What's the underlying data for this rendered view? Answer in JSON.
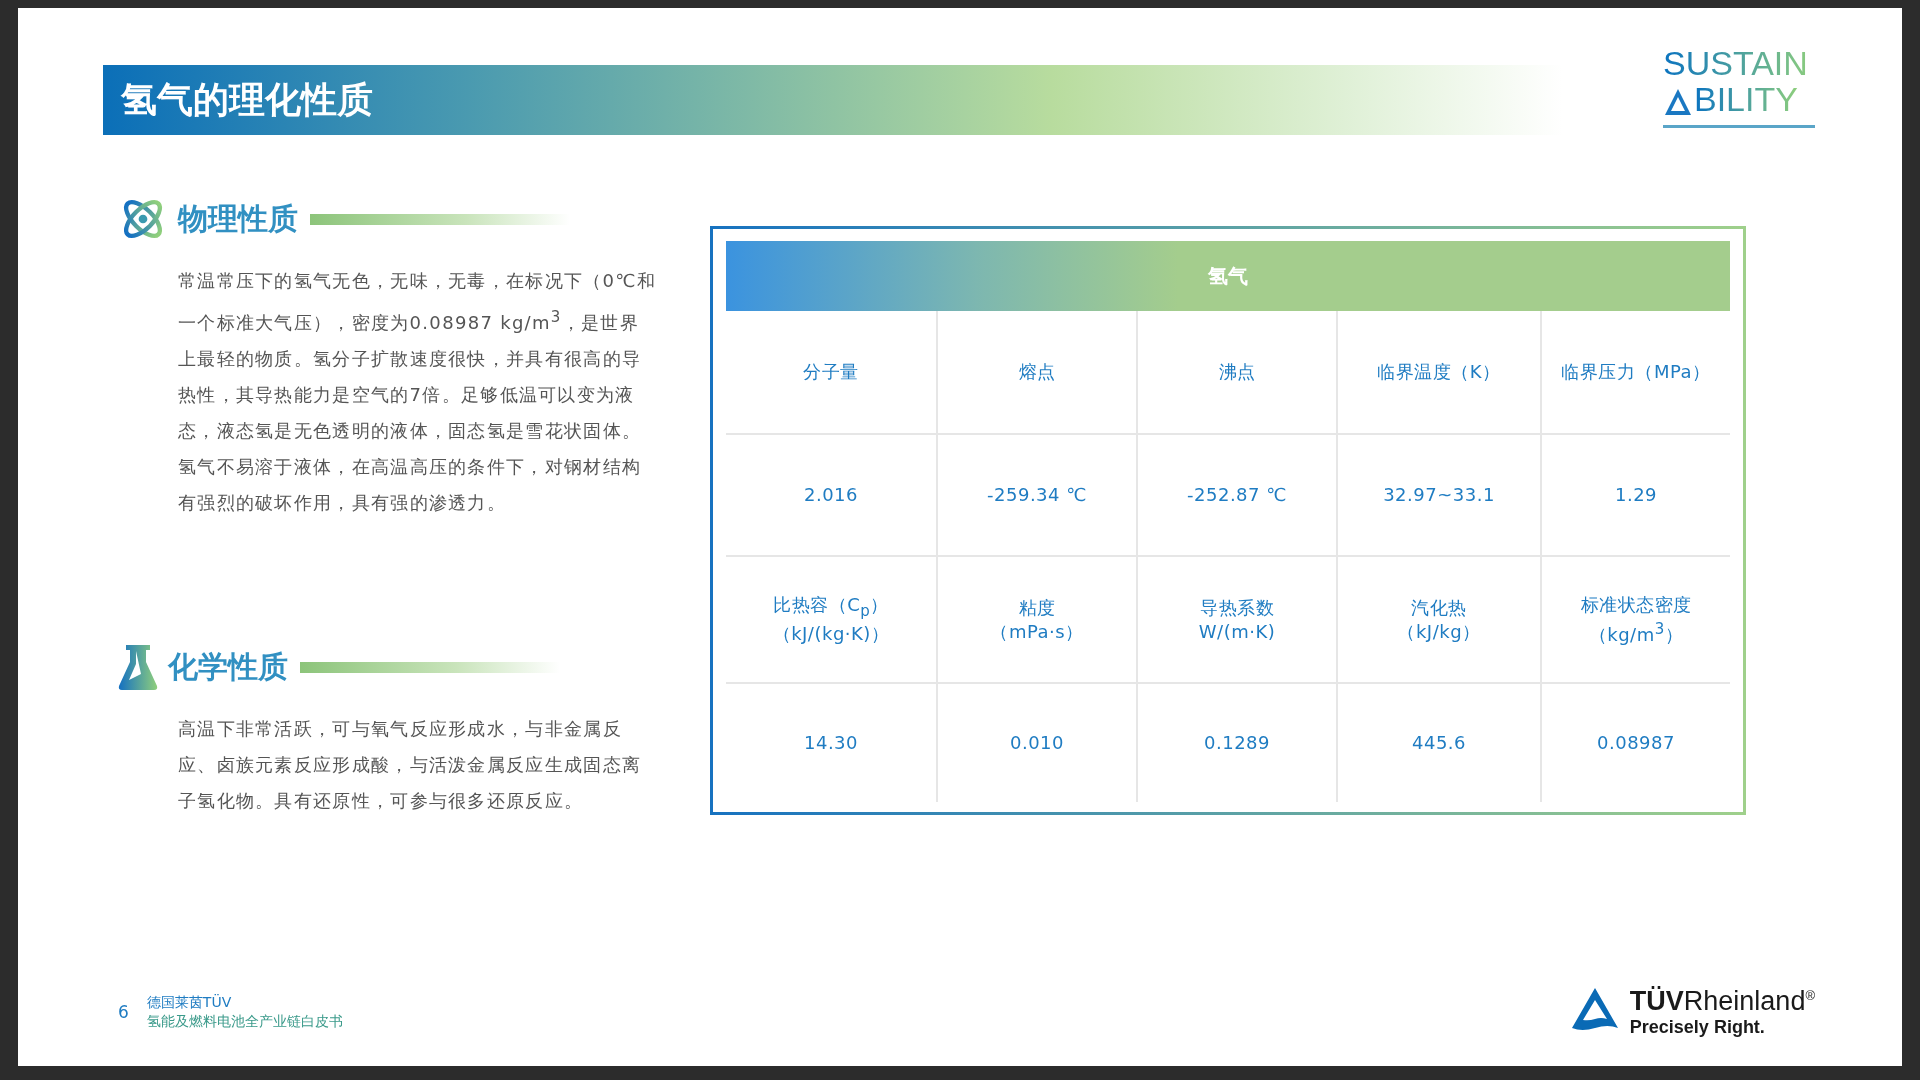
{
  "title": "氢气的理化性质",
  "logo": {
    "line_1": "SUSTAIN",
    "line_2": "BILITY"
  },
  "sections": [
    {
      "kind": "physical",
      "heading": "物理性质",
      "text": "常温常压下的氢气无色，无味，无毒，在标况下（0℃和一个标准大气压），密度为0.08987 kg/m$^{3}$，是世界上最轻的物质。氢分子扩散速度很快，并具有很高的导热性，其导热能力是空气的7倍。足够低温可以变为液态，液态氢是无色透明的液体，固态氢是雪花状固体。氢气不易溶于液体，在高温高压的条件下，对钢材结构有强烈的破坏作用，具有强的渗透力。"
    },
    {
      "kind": "chemical",
      "heading": "化学性质",
      "text": "高温下非常活跃，可与氧气反应形成水，与非金属反应、卤族元素反应形成酸，与活泼金属反应生成固态离子氢化物。具有还原性，可参与很多还原反应。"
    }
  ],
  "table": {
    "header": "氢气",
    "rows": [
      {
        "kind": "label",
        "cells": [
          {
            "name": "分子量"
          },
          {
            "name": "熔点"
          },
          {
            "name": "沸点"
          },
          {
            "name": "临界温度（K）"
          },
          {
            "name": "临界压力（MPa）"
          }
        ]
      },
      {
        "kind": "value",
        "cells": [
          "2.016",
          "-259.34 ℃",
          "-252.87 ℃",
          "32.97~33.1",
          "1.29"
        ]
      },
      {
        "kind": "label",
        "cells": [
          {
            "name": "比热容（C$_{p}$）",
            "unit": "（kJ/(kg·K)）"
          },
          {
            "name": "粘度",
            "unit": "（mPa·s）"
          },
          {
            "name": "导热系数",
            "unit": "W/(m·K)"
          },
          {
            "name": "汽化热",
            "unit": "（kJ/kg）"
          },
          {
            "name": "标准状态密度",
            "unit": "（kg/m$^{3}$）"
          }
        ]
      },
      {
        "kind": "value",
        "cells": [
          "14.30",
          "0.010",
          "0.1289",
          "445.6",
          "0.08987"
        ]
      }
    ]
  },
  "footer": {
    "page_number": "6",
    "line_1": "德国莱茵TÜV",
    "line_2": "氢能及燃料电池全产业链白皮书"
  },
  "brand": {
    "name": "**TÜV**Rheinland$^{®}$",
    "tagline": "Precisely Right."
  }
}
